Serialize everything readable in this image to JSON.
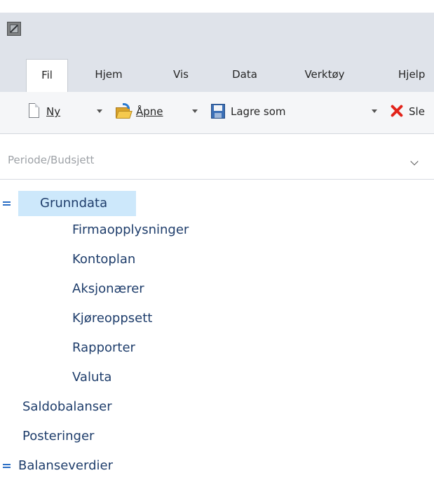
{
  "ribbon": {
    "tabs": [
      {
        "label": "Fil",
        "active": true
      },
      {
        "label": "Hjem",
        "active": false
      },
      {
        "label": "Vis",
        "active": false
      },
      {
        "label": "Data",
        "active": false
      },
      {
        "label": "Verktøy",
        "active": false
      },
      {
        "label": "Hjelp",
        "active": false
      }
    ]
  },
  "toolbar": {
    "new": {
      "label": "Ny",
      "icon": "new-document-icon"
    },
    "open": {
      "label": "Åpne",
      "icon": "open-folder-icon"
    },
    "save_as": {
      "label": "Lagre som",
      "icon": "floppy-disk-icon"
    },
    "delete": {
      "label": "Sle",
      "icon": "delete-x-icon"
    }
  },
  "period_select": {
    "placeholder": "Periode/Budsjett",
    "icon": "chevron-down-icon"
  },
  "tree": [
    {
      "label": "Grunndata",
      "expanded": true,
      "selected": true,
      "level": 0,
      "children": [
        {
          "label": "Firmaopplysninger"
        },
        {
          "label": "Kontoplan"
        },
        {
          "label": "Aksjonærer"
        },
        {
          "label": "Kjøreoppsett"
        },
        {
          "label": "Rapporter"
        },
        {
          "label": "Valuta"
        }
      ]
    },
    {
      "label": "Saldobalanser",
      "level": 0
    },
    {
      "label": "Posteringer",
      "level": 0
    },
    {
      "label": "Balanseverdier",
      "expanded": true,
      "level": 0
    }
  ],
  "colors": {
    "accent": "#2a6ec5",
    "selection": "#cde8fb",
    "tree_text": "#1e3d6b",
    "chrome": "#dfe3ea"
  }
}
